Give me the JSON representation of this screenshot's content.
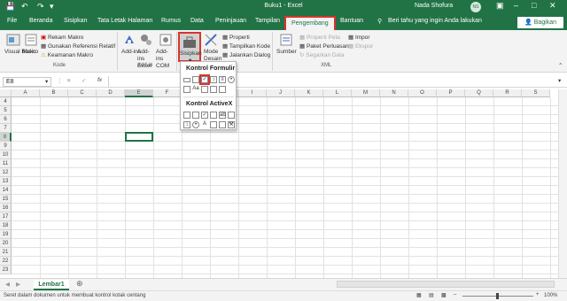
{
  "window": {
    "title": "Buku1  -  Excel",
    "user": "Nada Shofura",
    "avatar": "NS"
  },
  "tabs": [
    "File",
    "Beranda",
    "Sisipkan",
    "Tata Letak Halaman",
    "Rumus",
    "Data",
    "Peninjauan",
    "Tampilan",
    "Pengembang",
    "Bantuan"
  ],
  "tell_me": "Beri tahu yang ingin Anda lakukan",
  "share": "Bagikan",
  "ribbon": {
    "kode": {
      "visual_basic": "Visual Basic",
      "makro": "Makro",
      "rekam": "Rekam Makro",
      "referensi": "Gunakan Referensi Relatif",
      "keamanan": "Keamanan Makro",
      "label": "Kode"
    },
    "addin": {
      "addins": "Add-ins",
      "excel": "Add-ins Excel",
      "com": "Add-ins COM",
      "label": "Add-in"
    },
    "kontrol": {
      "sisipkan": "Sisipkan",
      "mode": "Mode Desain",
      "properti": "Properti",
      "tampilkan": "Tampilkan Kode",
      "jalankan": "Jalankan Dialog"
    },
    "xml": {
      "sumber": "Sumber",
      "peta": "Properti Peta",
      "paket": "Paket Perluasan",
      "segarkan": "Segarkan Data",
      "impor": "Impor",
      "ekspor": "Ekspor",
      "label": "XML"
    }
  },
  "namebox": "E8",
  "fx": "fx",
  "dropdown": {
    "form_title": "Kontrol Formulir",
    "activex_title": "Kontrol ActiveX"
  },
  "columns": [
    "A",
    "B",
    "C",
    "D",
    "E",
    "F",
    "G",
    "H",
    "I",
    "J",
    "K",
    "L",
    "M",
    "N",
    "O",
    "P",
    "Q",
    "R",
    "S"
  ],
  "rows": [
    "4",
    "5",
    "6",
    "7",
    "8",
    "9",
    "10",
    "11",
    "12",
    "13",
    "14",
    "15",
    "16",
    "17",
    "18",
    "19",
    "20",
    "21",
    "22",
    "23"
  ],
  "sheet": "Lembar1",
  "status": "Seret dalam dokumen untuk membuat kontrol kotak centang",
  "zoom": "100%",
  "colors": {
    "excel_green": "#217346",
    "highlight_red": "#d9342b"
  }
}
